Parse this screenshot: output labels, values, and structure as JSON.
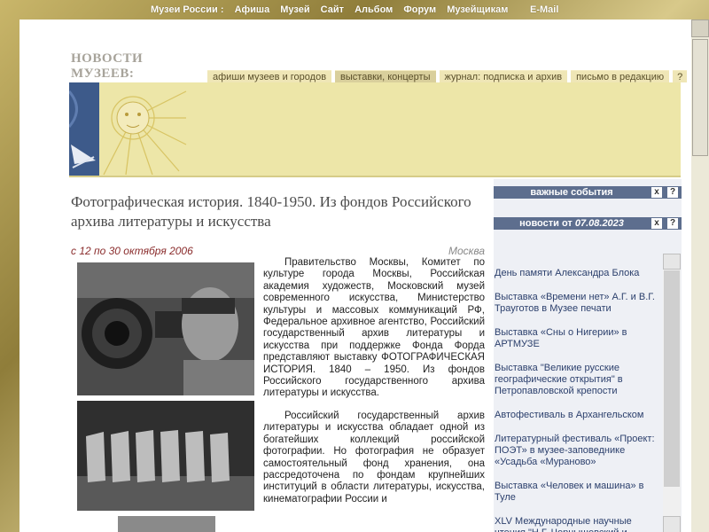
{
  "nav": {
    "items": [
      "Музеи России :",
      "Афиша",
      "Музей",
      "Сайт",
      "Альбом",
      "Форум",
      "Музейщикам"
    ],
    "email": "E-Mail"
  },
  "brand": {
    "line1": "НОВОСТИ",
    "line2": "МУЗЕЕВ:"
  },
  "tabs": [
    {
      "label": "афиши музеев и городов"
    },
    {
      "label": "выставки, концерты"
    },
    {
      "label": "журнал: подписка и архив"
    },
    {
      "label": "письмо в редакцию"
    },
    {
      "label": "?"
    }
  ],
  "article": {
    "title": "Фотографическая история. 1840-1950. Из фондов Российского архива литературы и искусства",
    "dates": "с 12 по 30 октября 2006",
    "city": "Москва",
    "para1": "Правительство Москвы, Комитет по культуре города Москвы, Российская академия художеств, Московский музей современного искусства, Министерство культуры и массовых коммуникаций РФ, Федеральное архивное агентство, Российский государственный архив литературы и искусства при поддержке Фонда Форда представляют выставку ФОТОГРАФИЧЕСКАЯ ИСТОРИЯ. 1840 – 1950. Из фондов Российского государственного архива литературы и искусства.",
    "para2": "Российский государственный архив литературы и искусства обладает одной из богатейших коллекций российской фотографии. Но фотография не образует самостоятельный фонд хранения, она рассредоточена по фондам крупнейших институций в области литературы, искусства, кинематографии России и"
  },
  "sidebar": {
    "important_title": "важные события",
    "news_prefix": "новости от ",
    "news_date": "07.08.2023",
    "btn_close": "x",
    "btn_help": "?",
    "items": [
      "День памяти Александра Блока",
      "Выставка «Времени нет» А.Г. и В.Г. Трауготов в Музее печати",
      "Выставка «Сны о Нигерии» в АРТМУЗЕ",
      "Выставка \"Великие русские географические открытия\" в Петропавловской крепости",
      "Автофестиваль в Архангельском",
      "Литературный фестиваль «Проект: ПОЭТ» в музее-заповеднике «Усадьба «Мураново»",
      "Выставка «Человек и машина» в Туле",
      "XLV Международные научные чтения \"Н.Г. Чернышевский и"
    ]
  }
}
